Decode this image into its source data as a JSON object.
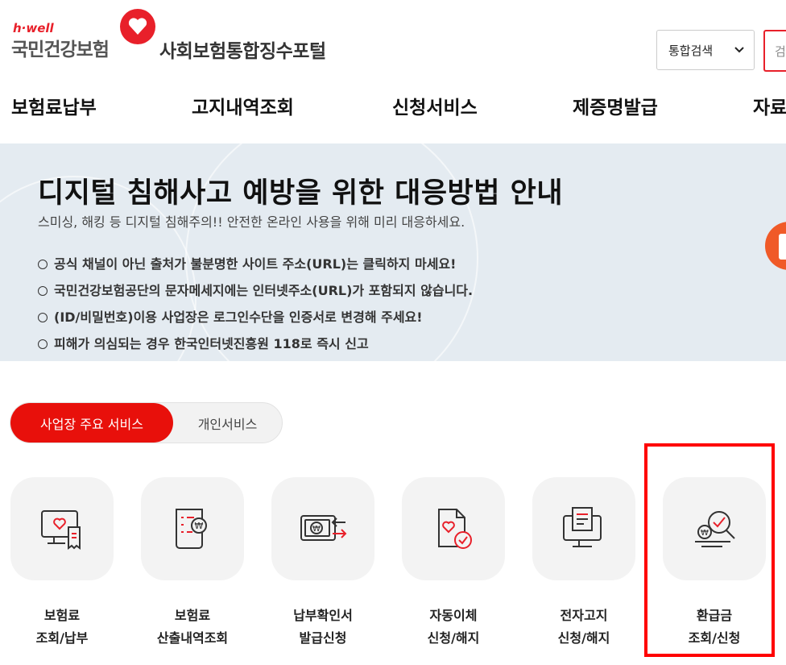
{
  "header": {
    "logo_small": "h·well",
    "logo_big": "국민건강보험",
    "portal_title": "사회보험통합징수포털",
    "search_select": "통합검색",
    "search_placeholder": "검"
  },
  "nav": [
    "보험료납부",
    "고지내역조회",
    "신청서비스",
    "제증명발급",
    "자료"
  ],
  "banner": {
    "title": "디지털 침해사고 예방을 위한 대응방법 안내",
    "subtitle": "스미싱, 해킹 등 디지털 침해주의!! 안전한 온라인 사용을 위해 미리 대응하세요.",
    "items": [
      "공식 채널이 아닌 출처가 불분명한 사이트 주소(URL)는 클릭하지 마세요!",
      "국민건강보험공단의 문자메세지에는 인터넷주소(URL)가 포함되지 않습니다.",
      "(ID/비밀번호)이용 사업장은 로그인수단을 인증서로 변경해 주세요!",
      "피해가 의심되는 경우 한국인터넷진흥원 118로 즉시 신고"
    ]
  },
  "tabs": {
    "active": "사업장 주요 서비스",
    "inactive": "개인서비스"
  },
  "services": [
    {
      "line1": "보험료",
      "line2": "조회/납부",
      "icon": "monitor-receipt-icon"
    },
    {
      "line1": "보험료",
      "line2": "산출내역조회",
      "icon": "document-won-icon"
    },
    {
      "line1": "납부확인서",
      "line2": "발급신청",
      "icon": "card-transfer-icon"
    },
    {
      "line1": "자동이체",
      "line2": "신청/해지",
      "icon": "document-check-icon"
    },
    {
      "line1": "전자고지",
      "line2": "신청/해지",
      "icon": "monitor-notice-icon"
    },
    {
      "line1": "환급금",
      "line2": "조회/신청",
      "icon": "refund-search-icon"
    }
  ],
  "colors": {
    "accent": "#e8100b",
    "banner_bg": "#e4ebf1",
    "highlight": "#ff0000"
  }
}
